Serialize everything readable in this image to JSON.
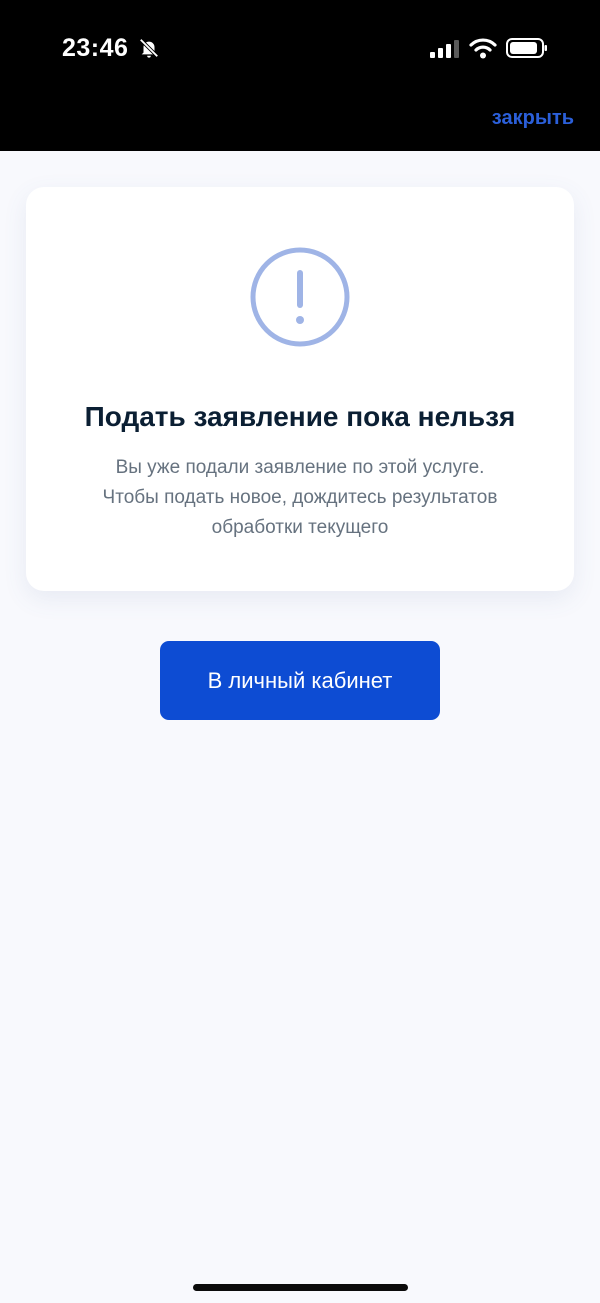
{
  "status_bar": {
    "time": "23:46",
    "icons": [
      "bell-off-icon",
      "signal-icon",
      "wifi-icon",
      "battery-icon"
    ]
  },
  "header": {
    "close_label": "закрыть"
  },
  "card": {
    "icon": "exclamation-circle-icon",
    "title": "Подать заявление пока нельзя",
    "text_lines": [
      "Вы уже подали заявление по этой услуге.",
      "Чтобы подать новое, дождитесь результатов",
      "обработки текущего"
    ]
  },
  "actions": {
    "cabinet_label": "В личный кабинет"
  },
  "colors": {
    "accent": "#0d4cd3",
    "link": "#2b5fd9",
    "icon": "#9fb4e6",
    "title": "#0b1f33",
    "text": "#66727f",
    "background": "#f8f9fd"
  }
}
